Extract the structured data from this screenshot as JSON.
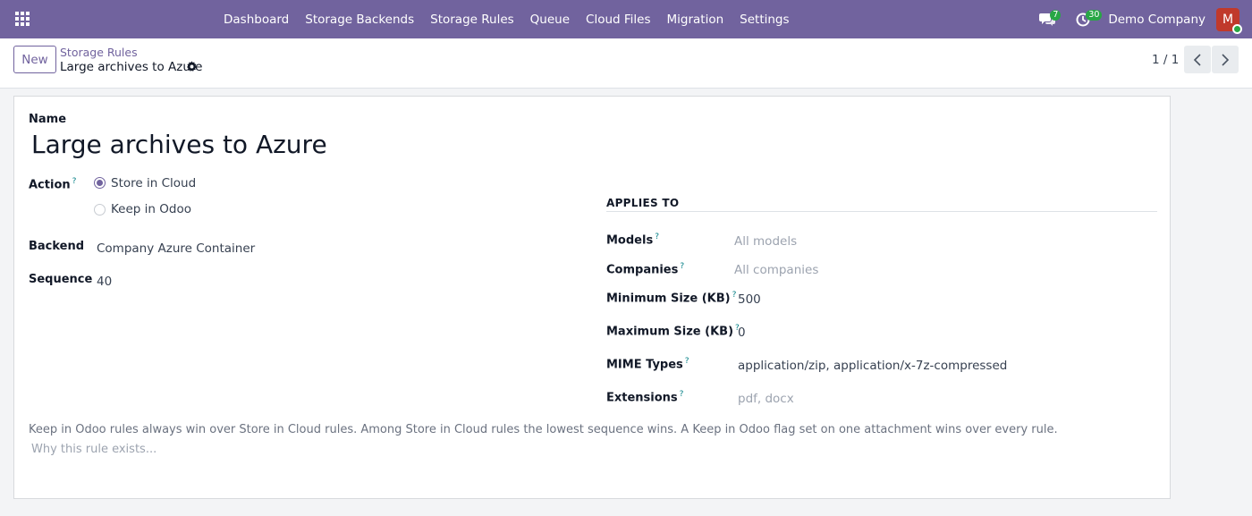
{
  "navbar": {
    "menu": [
      "Dashboard",
      "Storage Backends",
      "Storage Rules",
      "Queue",
      "Cloud Files",
      "Migration",
      "Settings"
    ],
    "messages_count": "7",
    "activities_count": "30",
    "company": "Demo Company",
    "avatar_initial": "M",
    "colors": {
      "navbar": "#71639e",
      "badge": "#28a745",
      "avatar": "#c0392b"
    }
  },
  "control_panel": {
    "new_label": "New",
    "breadcrumb_parent": "Storage Rules",
    "breadcrumb_current": "Large archives to Azure",
    "pager": "1 / 1"
  },
  "form": {
    "name_label": "Name",
    "name_value": "Large archives to Azure",
    "action_label": "Action",
    "action_help": "?",
    "action_options": [
      "Store in Cloud",
      "Keep in Odoo"
    ],
    "action_selected": "Store in Cloud",
    "backend_label": "Backend",
    "backend_value": "Company Azure Container",
    "sequence_label": "Sequence",
    "sequence_value": "40",
    "applies_to": {
      "header": "APPLIES TO",
      "models_label": "Models",
      "models_placeholder": "All models",
      "companies_label": "Companies",
      "companies_placeholder": "All companies",
      "min_size_label": "Minimum Size (KB)",
      "min_size_value": "500",
      "max_size_label": "Maximum Size (KB)",
      "max_size_value": "0",
      "mime_label": "MIME Types",
      "mime_value": "application/zip, application/x-7z-compressed",
      "ext_label": "Extensions",
      "ext_placeholder": "pdf, docx"
    },
    "note": "Keep in Odoo rules always win over Store in Cloud rules. Among Store in Cloud rules the lowest sequence wins. A Keep in Odoo flag set on one attachment wins over every rule.",
    "reason_placeholder": "Why this rule exists..."
  }
}
